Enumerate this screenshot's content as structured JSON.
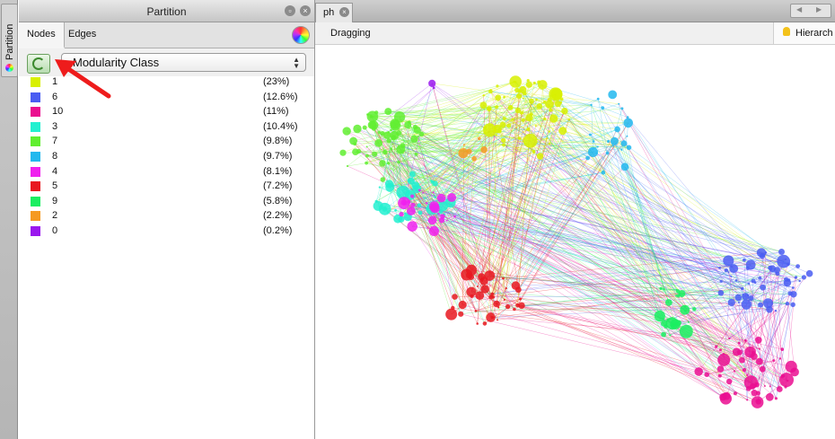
{
  "sidebar": {
    "tab_label": "Partition"
  },
  "panel": {
    "title": "Partition",
    "tabs": [
      {
        "label": "Nodes"
      },
      {
        "label": "Edges"
      }
    ],
    "dropdown_value": "Modularity Class",
    "legend": [
      {
        "label": "1",
        "pct": "(23%)",
        "color": "#d8f000"
      },
      {
        "label": "6",
        "pct": "(12.6%)",
        "color": "#4a5df2"
      },
      {
        "label": "10",
        "pct": "(11%)",
        "color": "#ea0e90"
      },
      {
        "label": "3",
        "pct": "(10.4%)",
        "color": "#22f0d0"
      },
      {
        "label": "7",
        "pct": "(9.8%)",
        "color": "#60ee30"
      },
      {
        "label": "8",
        "pct": "(9.7%)",
        "color": "#22b8ee"
      },
      {
        "label": "4",
        "pct": "(8.1%)",
        "color": "#f020ee"
      },
      {
        "label": "5",
        "pct": "(7.2%)",
        "color": "#e81820"
      },
      {
        "label": "9",
        "pct": "(5.8%)",
        "color": "#1aee60"
      },
      {
        "label": "2",
        "pct": "(2.2%)",
        "color": "#f59a22"
      },
      {
        "label": "0",
        "pct": "(0.2%)",
        "color": "#9a18ee"
      }
    ]
  },
  "main": {
    "doc_tab_label": "ph",
    "mode": "Dragging",
    "hint": "Hierarch"
  },
  "colors": {
    "annotation_arrow": "#ee1c1c"
  }
}
